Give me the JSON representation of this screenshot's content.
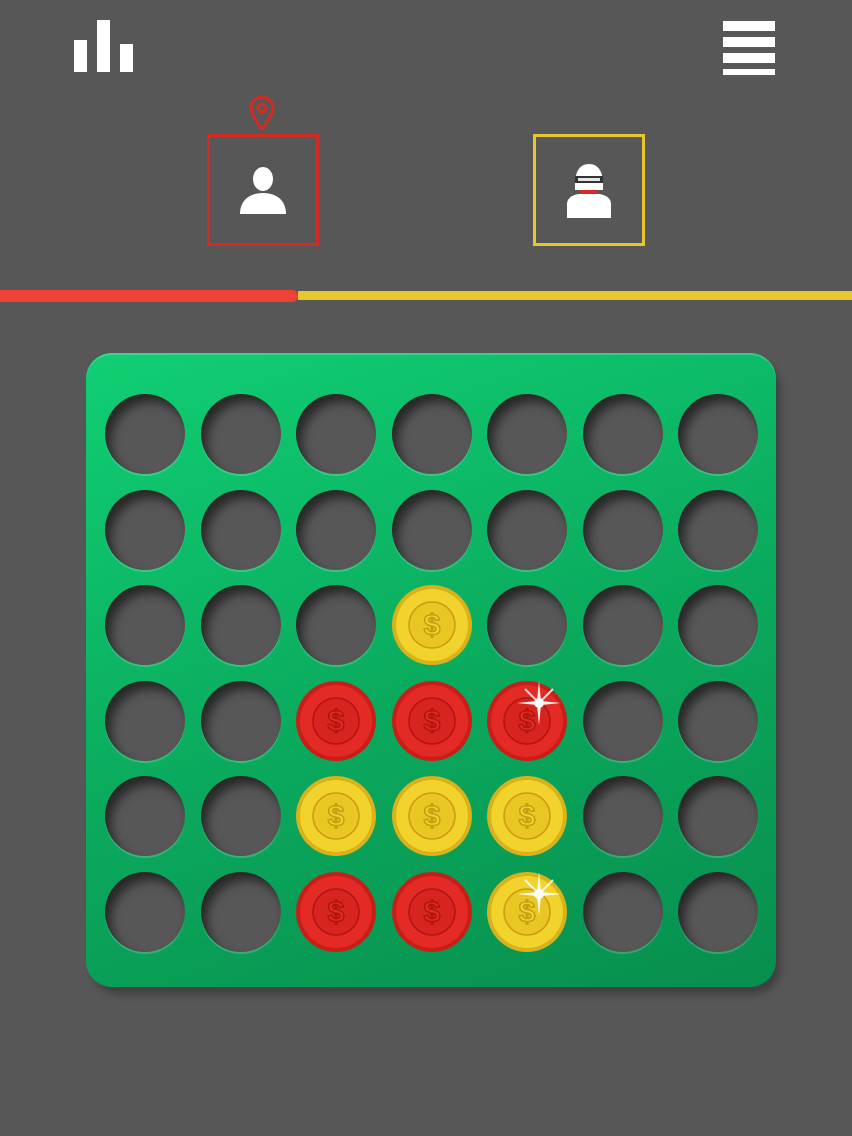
{
  "header": {
    "stats_icon": "bar-chart-icon",
    "menu_icon": "hamburger-menu-icon"
  },
  "players": [
    {
      "name": "human",
      "icon": "person-icon",
      "color": "#d42c24",
      "active": true,
      "marker_icon": "location-pin-icon"
    },
    {
      "name": "robot",
      "icon": "robot-icon",
      "color": "#e6c82e",
      "active": false
    }
  ],
  "turn_progress": {
    "red_fraction": 0.35,
    "red_color": "#ef4136",
    "yellow_color": "#e6c82e"
  },
  "board": {
    "rows": 6,
    "cols": 7,
    "color": "#0fb866",
    "disc_symbol": "$",
    "grid": [
      [
        null,
        null,
        null,
        null,
        null,
        null,
        null
      ],
      [
        null,
        null,
        null,
        null,
        null,
        null,
        null
      ],
      [
        null,
        null,
        null,
        "yellow",
        null,
        null,
        null
      ],
      [
        null,
        null,
        "red",
        "red",
        "red",
        null,
        null
      ],
      [
        null,
        null,
        "yellow",
        "yellow",
        "yellow",
        null,
        null
      ],
      [
        null,
        null,
        "red",
        "red",
        "yellow",
        null,
        null
      ]
    ],
    "sparkles": [
      [
        3,
        4
      ],
      [
        5,
        4
      ]
    ]
  }
}
